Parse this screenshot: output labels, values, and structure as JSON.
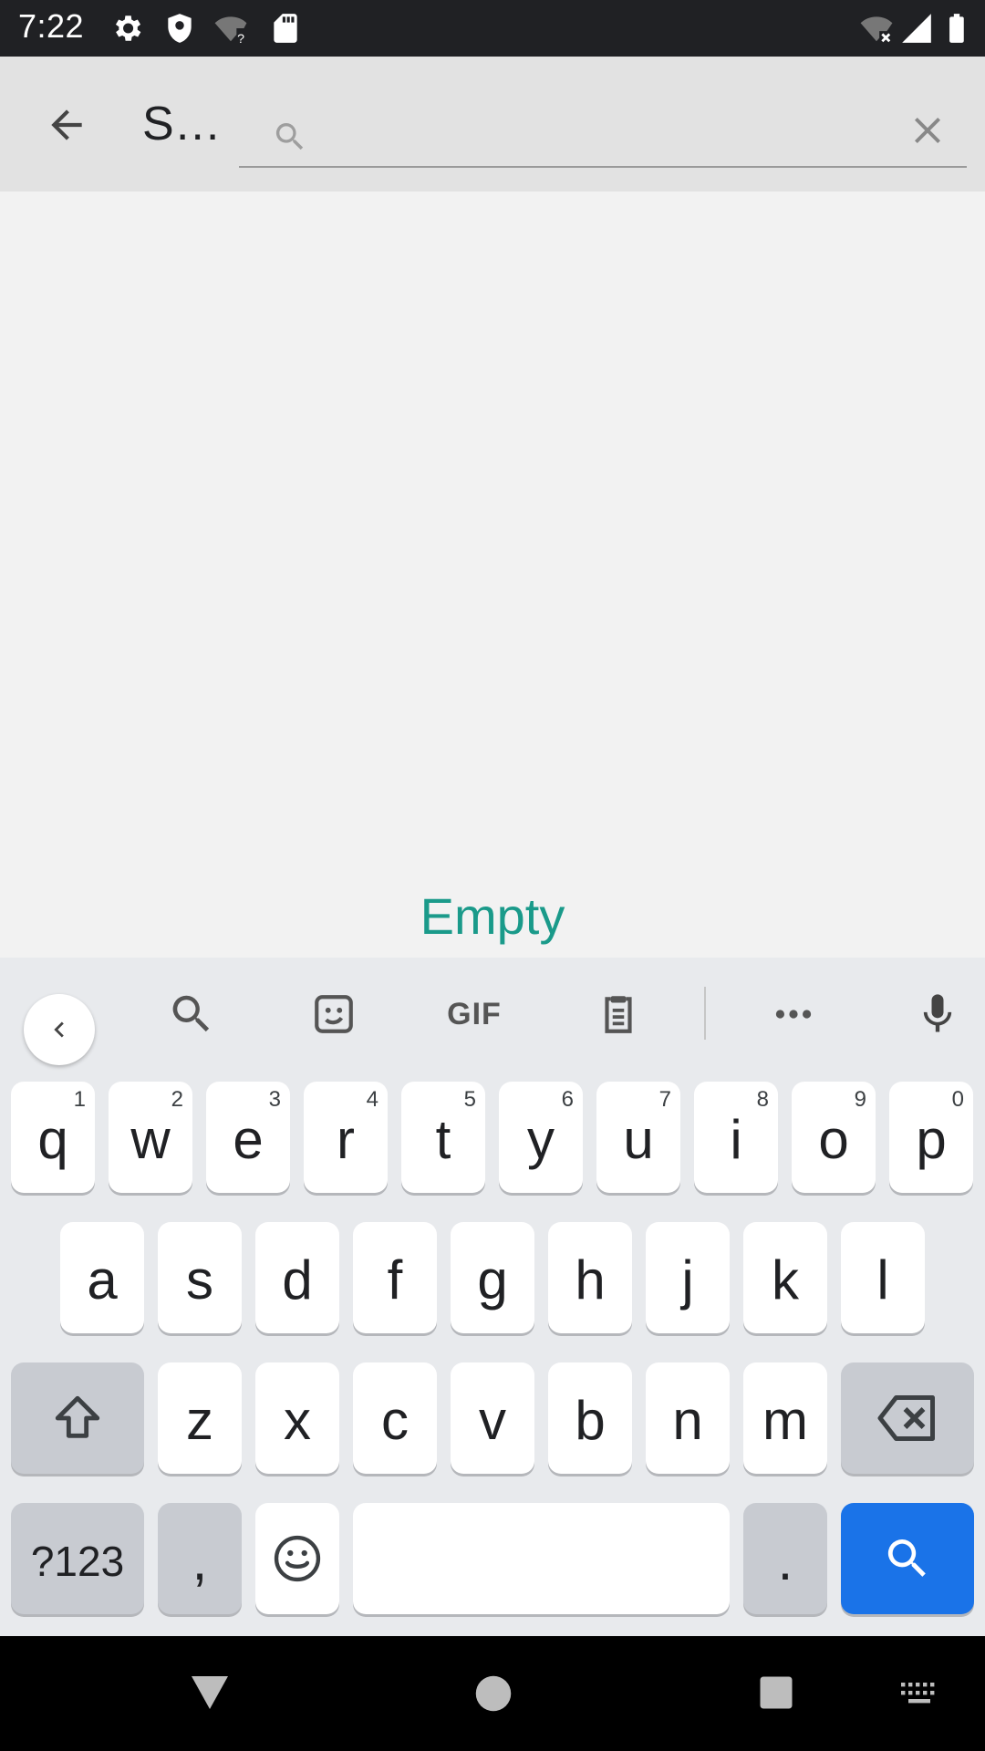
{
  "status_bar": {
    "time": "7:22",
    "icons": [
      "settings-icon",
      "shield-icon",
      "wifi-question-icon",
      "sd-card-icon",
      "wifi-off-icon",
      "signal-icon",
      "battery-icon"
    ]
  },
  "app_bar": {
    "back_icon": "arrow-back-icon",
    "title": "S…",
    "search": {
      "value": "",
      "placeholder": "",
      "icon": "search-icon"
    },
    "clear_icon": "close-icon"
  },
  "content": {
    "empty_label": "Empty"
  },
  "keyboard": {
    "toolbar": [
      "chevron-left-icon",
      "search-icon",
      "sticker-icon",
      "GIF",
      "clipboard-icon",
      "more-icon",
      "mic-icon"
    ],
    "gif_label": "GIF",
    "row1": [
      {
        "k": "q",
        "h": "1"
      },
      {
        "k": "w",
        "h": "2"
      },
      {
        "k": "e",
        "h": "3"
      },
      {
        "k": "r",
        "h": "4"
      },
      {
        "k": "t",
        "h": "5"
      },
      {
        "k": "y",
        "h": "6"
      },
      {
        "k": "u",
        "h": "7"
      },
      {
        "k": "i",
        "h": "8"
      },
      {
        "k": "o",
        "h": "9"
      },
      {
        "k": "p",
        "h": "0"
      }
    ],
    "row2": [
      "a",
      "s",
      "d",
      "f",
      "g",
      "h",
      "j",
      "k",
      "l"
    ],
    "row3": [
      "z",
      "x",
      "c",
      "v",
      "b",
      "n",
      "m"
    ],
    "sym_label": "?123",
    "comma": ",",
    "period": ".",
    "accent_color": "#1a73e8"
  },
  "nav_bar": {
    "icons": [
      "back-triangle-icon",
      "home-circle-icon",
      "recents-square-icon",
      "keyboard-icon"
    ]
  }
}
